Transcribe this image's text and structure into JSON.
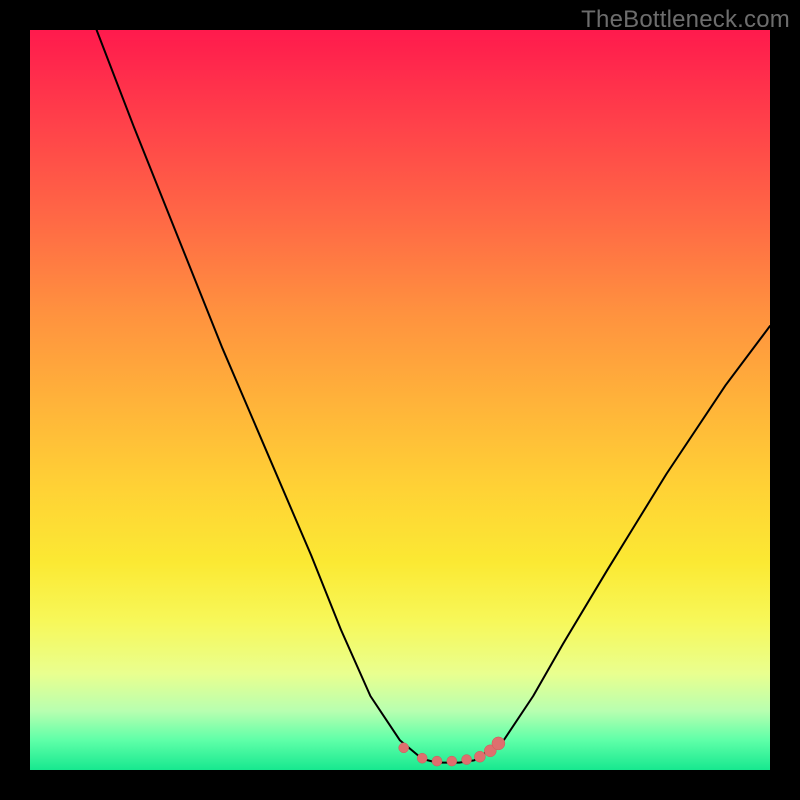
{
  "watermark": {
    "text": "TheBottleneck.com"
  },
  "colors": {
    "frame": "#000000",
    "curve_stroke": "#000000",
    "marker_fill": "#de6f6e",
    "marker_stroke": "#cf5a59"
  },
  "chart_data": {
    "type": "line",
    "title": "",
    "xlabel": "",
    "ylabel": "",
    "xlim": [
      0,
      100
    ],
    "ylim": [
      0,
      100
    ],
    "grid": false,
    "series": [
      {
        "name": "bottleneck-curve",
        "x": [
          9,
          14,
          20,
          26,
          32,
          38,
          42,
          46,
          50,
          53,
          55,
          58,
          60,
          64,
          68,
          72,
          78,
          86,
          94,
          100
        ],
        "y": [
          100,
          87,
          72,
          57,
          43,
          29,
          19,
          10,
          4,
          1.5,
          1,
          1,
          1.3,
          4,
          10,
          17,
          27,
          40,
          52,
          60
        ]
      }
    ],
    "markers": [
      {
        "x": 50.5,
        "y": 3.0,
        "r": 5
      },
      {
        "x": 53.0,
        "y": 1.6,
        "r": 5
      },
      {
        "x": 55.0,
        "y": 1.2,
        "r": 5
      },
      {
        "x": 57.0,
        "y": 1.2,
        "r": 5
      },
      {
        "x": 59.0,
        "y": 1.4,
        "r": 5
      },
      {
        "x": 60.8,
        "y": 1.8,
        "r": 5.5
      },
      {
        "x": 62.2,
        "y": 2.6,
        "r": 6
      },
      {
        "x": 63.3,
        "y": 3.6,
        "r": 6.5
      }
    ]
  }
}
